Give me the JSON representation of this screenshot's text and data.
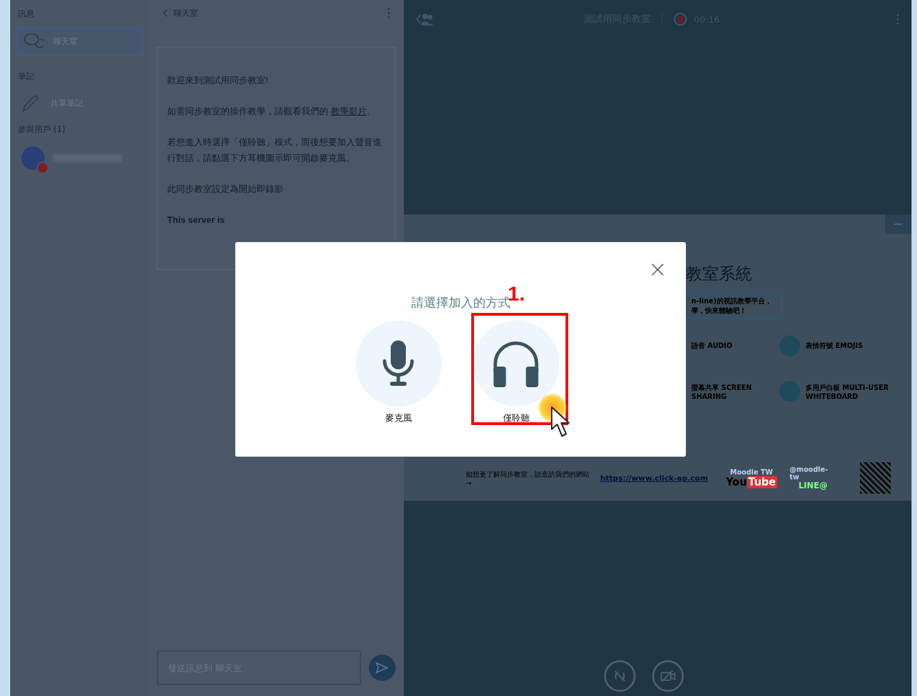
{
  "sidebar": {
    "messages_heading": "訊息",
    "chat_item": {
      "label": "聊天室",
      "selected": true
    },
    "notes_heading": "筆記",
    "notes_item": {
      "label": "共享筆記"
    },
    "users_heading": "參與用戶 (1)"
  },
  "chat": {
    "title": "聊天室",
    "messages": [
      {
        "kind": "text",
        "text": "歡迎來到測試用同步教室!"
      },
      {
        "kind": "text",
        "text": "如需同步教室的操作教學，請觀看我們的 ",
        "link": "教學影片",
        "after": "。"
      },
      {
        "kind": "text",
        "text": "若您進入時選擇「僅聆聽」模式，而後想要加入聲音進行對話，請點選下方耳機圖示即可開啟麥克風。"
      },
      {
        "kind": "text",
        "text": "此同步教室設定為開始即錄影"
      },
      {
        "kind": "bold",
        "text": "This server is"
      }
    ],
    "input": {
      "placeholder": "發送訊息到 聊天室"
    }
  },
  "topbar": {
    "title": "測試用同步教室",
    "recording": true,
    "timer": "00:16"
  },
  "slide": {
    "heading": "教室系統",
    "tagline": [
      "n-line)的視訊教學平台，",
      "學，快來體驗吧！"
    ],
    "features": [
      {
        "title": "語音 AUDIO"
      },
      {
        "title": "表情符號 EMOJIS"
      },
      {
        "title": "螢幕共享 SCREEN SHARING"
      },
      {
        "title": "多用戶白板 MULTI-USER WHITEBOARD"
      }
    ],
    "footer": "如想更了解同步教室，請造訪我們的網站 →",
    "url": "https://www.click-ap.com",
    "youtube_label": "Moodle TW",
    "youtube_logo": [
      "You",
      "Tube"
    ],
    "line_label": "@moodle-tw",
    "line_logo": "LINE@"
  },
  "dialog": {
    "title": "請選擇加入的方式",
    "options": [
      {
        "kind": "microphone",
        "label": "麥克風",
        "highlighted": false
      },
      {
        "kind": "headphones",
        "label": "僅聆聽",
        "highlighted": true
      }
    ],
    "step_label": "1."
  }
}
